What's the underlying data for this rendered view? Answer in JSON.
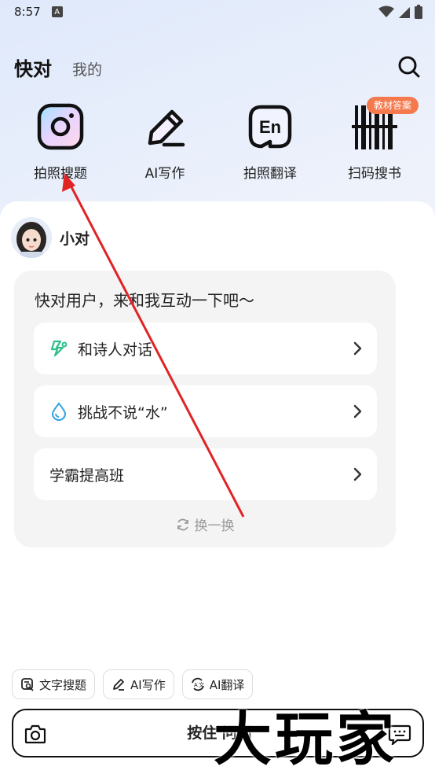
{
  "status_bar": {
    "time": "8:57",
    "notification_icon_letter": "A"
  },
  "top_nav": {
    "tabs": [
      {
        "label": "快对",
        "active": true
      },
      {
        "label": "我的",
        "active": false
      }
    ]
  },
  "tools": [
    {
      "label": "拍照搜题",
      "icon": "camera-icon"
    },
    {
      "label": "AI写作",
      "icon": "pen-icon"
    },
    {
      "label": "拍照翻译",
      "icon": "translate-en-icon"
    },
    {
      "label": "扫码搜书",
      "icon": "barcode-icon",
      "badge": "教材答案"
    }
  ],
  "bot": {
    "name": "小对"
  },
  "card": {
    "title": "快对用户，来和我互动一下吧〜",
    "options": [
      {
        "label": "和诗人对话",
        "icon": "poet-icon"
      },
      {
        "label": "挑战不说“水”",
        "icon": "water-drop-icon"
      },
      {
        "label": "学霸提高班",
        "icon": ""
      }
    ],
    "refresh_label": "换一换"
  },
  "quick_actions": [
    {
      "label": "文字搜题",
      "icon": "text-search-icon"
    },
    {
      "label": "AI写作",
      "icon": "pen-icon"
    },
    {
      "label": "AI翻译",
      "icon": "translate-icon"
    }
  ],
  "input_bar": {
    "hold_label": "按住 问问"
  },
  "watermark": "大玩家",
  "colors": {
    "badge": "#f47a4e",
    "accent_green": "#2fbf8a",
    "water_blue": "#3ba6e6",
    "arrow": "#e02424"
  }
}
